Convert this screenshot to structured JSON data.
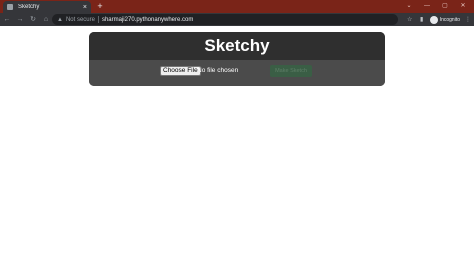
{
  "browser": {
    "tab": {
      "title": "Sketchy",
      "close_glyph": "×"
    },
    "new_tab_glyph": "+",
    "window_controls": [
      "⌄",
      "—",
      "▢",
      "✕"
    ],
    "nav": {
      "back": "←",
      "forward": "→",
      "reload": "↻",
      "home": "⌂"
    },
    "address_bar": {
      "security_label": "Not secure",
      "url": "sharmaji270.pythonanywhere.com"
    },
    "toolbar_icons": {
      "bookmark": "☆",
      "split": "▮"
    },
    "profile": {
      "label": "Incognito"
    },
    "menu_glyph": "⋮"
  },
  "page": {
    "title": "Sketchy",
    "file_input": {
      "button_label": "Choose File",
      "status": "No file chosen"
    },
    "submit_label": "Make Sketch"
  },
  "colors": {
    "tabstrip": "#7a2418",
    "toolbar": "#35363a",
    "card_header": "#2f2f2f",
    "card_body": "#4b4b4b",
    "submit": "#3a5e45"
  }
}
